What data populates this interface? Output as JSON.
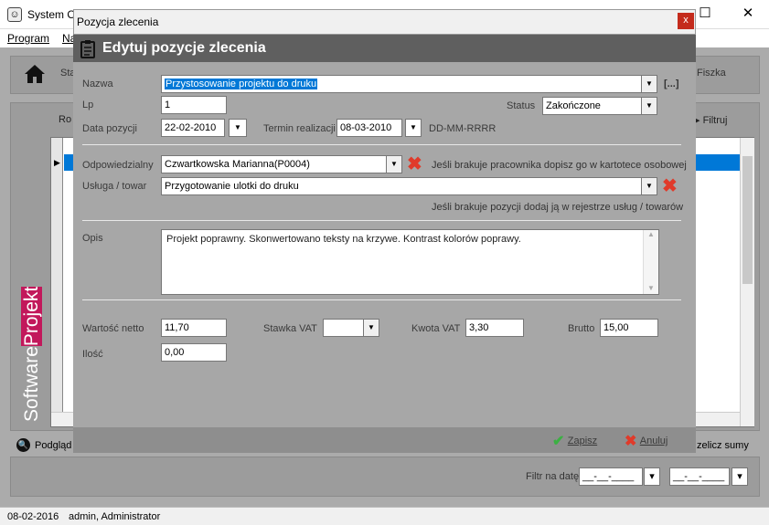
{
  "main_window": {
    "title": "System O",
    "menu": [
      "Program",
      "Na"
    ],
    "toolbar": {
      "left_text": "Sta",
      "right_text": "Fiszka"
    },
    "list": {
      "header_left": "Ro",
      "filter_label": "Filtruj"
    },
    "brand_text_a": "Software",
    "brand_text_b": "Projekt",
    "preview_label": "Podgląd",
    "recalc_label": "zelicz sumy",
    "date_filter_label": "Filtr na datę",
    "date_filter_from": "__-__-____",
    "date_filter_to": "__-__-____"
  },
  "statusbar": {
    "date": "08-02-2016",
    "user": "admin, Administrator"
  },
  "dialog": {
    "window_title": "Pozycja zlecenia",
    "close_glyph": "x",
    "header_title": "Edytuj pozycje zlecenia",
    "fields": {
      "nazwa_label": "Nazwa",
      "nazwa_value": "Przystosowanie projektu do druku",
      "more_button": "[...]",
      "lp_label": "Lp",
      "lp_value": "1",
      "status_label": "Status",
      "status_value": "Zakończone",
      "data_pozycji_label": "Data pozycji",
      "data_pozycji_value": "22-02-2010",
      "termin_label": "Termin realizacji",
      "termin_value": "08-03-2010",
      "date_format_hint": "DD-MM-RRRR",
      "odpowiedzialny_label": "Odpowiedzialny",
      "odpowiedzialny_value": "Czwartkowska Marianna(P0004)",
      "odpowiedzialny_hint": "Jeśli brakuje pracownika dopisz go w kartotece osobowej",
      "usluga_label": "Usługa / towar",
      "usluga_value": "Przygotowanie ulotki do druku",
      "usluga_hint": "Jeśli brakuje pozycji dodaj ją w rejestrze usług / towarów",
      "opis_label": "Opis",
      "opis_value": "Projekt poprawny. Skonwertowano teksty na krzywe. Kontrast kolorów poprawy.",
      "wartosc_label": "Wartość netto",
      "wartosc_value": "11,70",
      "vat_label": "Stawka VAT",
      "vat_value": "",
      "kwota_vat_label": "Kwota VAT",
      "kwota_vat_value": "3,30",
      "brutto_label": "Brutto",
      "brutto_value": "15,00",
      "ilosc_label": "Ilość",
      "ilosc_value": "0,00"
    },
    "buttons": {
      "save": "Zapisz",
      "cancel": "Anuluj"
    }
  },
  "colors": {
    "selection": "#0078d7",
    "header": "#5f5f5f",
    "body": "#a7a7a7",
    "danger": "#e03a2a",
    "ok": "#3cb043"
  }
}
